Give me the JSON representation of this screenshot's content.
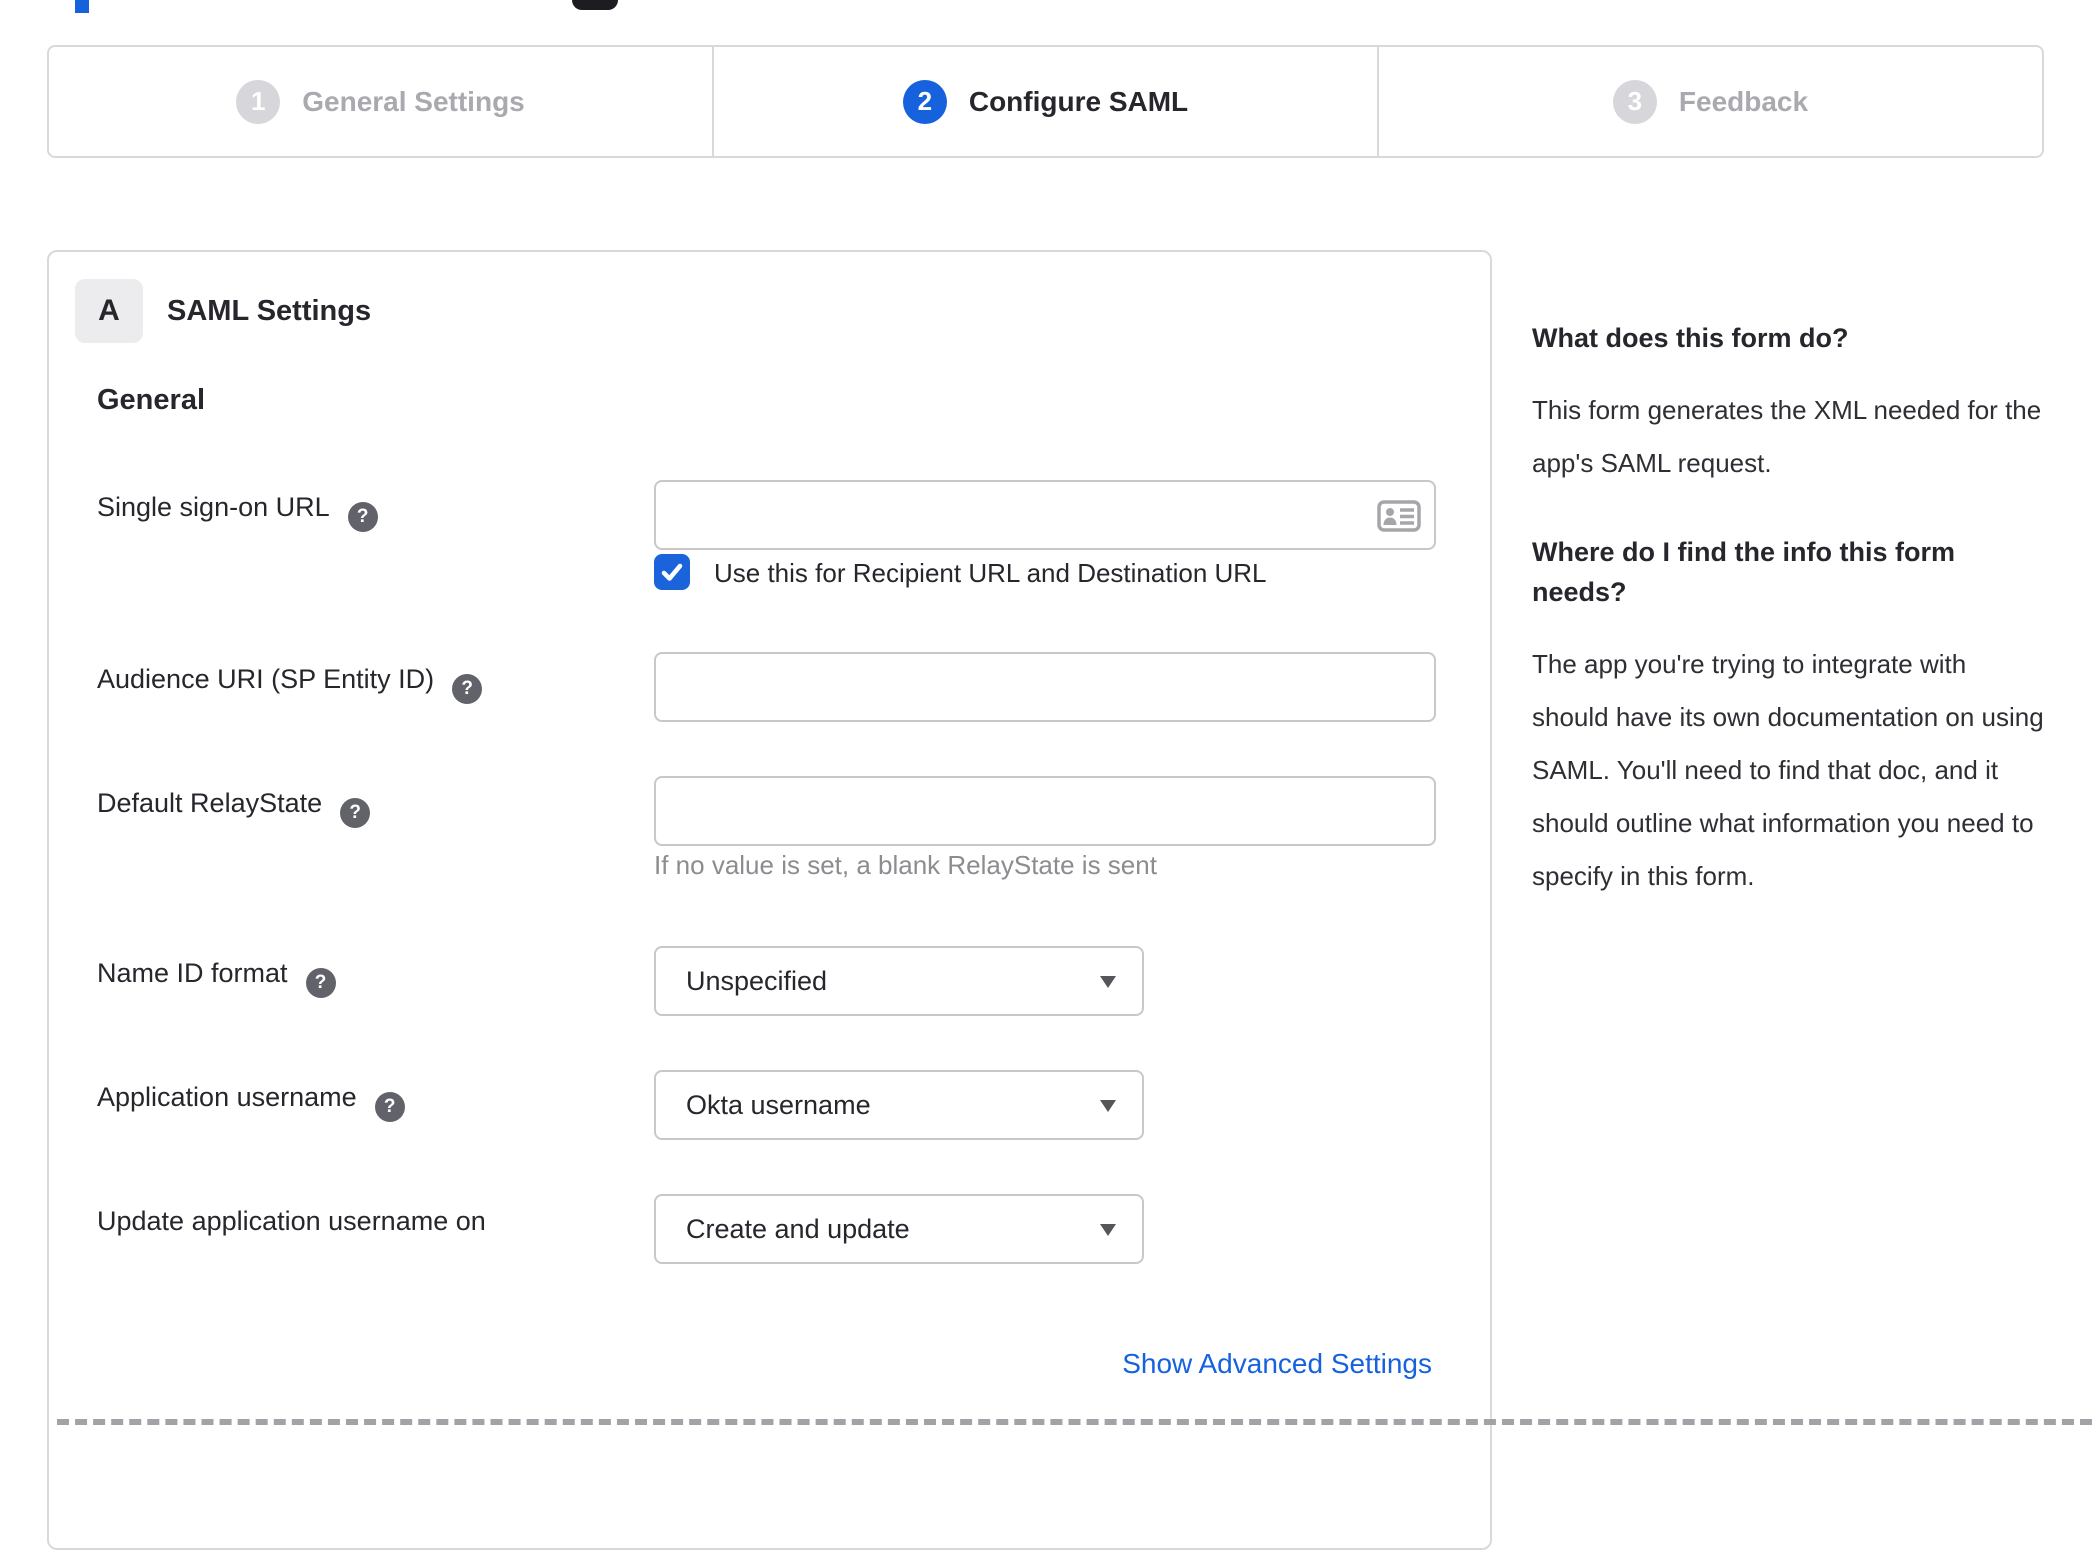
{
  "colors": {
    "accent_blue": "#1662dd",
    "dark_text": "#26262c",
    "inactive_gray": "#a9a9af",
    "hint_gray": "#8c8c91",
    "border_gray": "#d9d9dc",
    "input_border": "#c7c7cc"
  },
  "stepper": {
    "steps": [
      {
        "number": "1",
        "label": "General Settings",
        "state": "inactive"
      },
      {
        "number": "2",
        "label": "Configure SAML",
        "state": "active"
      },
      {
        "number": "3",
        "label": "Feedback",
        "state": "inactive"
      }
    ]
  },
  "panel": {
    "badge": "A",
    "title": "SAML Settings",
    "section_heading": "General",
    "help_glyph": "?",
    "fields": {
      "sso": {
        "label": "Single sign-on URL",
        "value": "",
        "checkbox_label": "Use this for Recipient URL and Destination URL",
        "checkbox_checked": true
      },
      "audience": {
        "label": "Audience URI (SP Entity ID)",
        "value": ""
      },
      "relay": {
        "label": "Default RelayState",
        "value": "",
        "hint": "If no value is set, a blank RelayState is sent"
      },
      "name_id": {
        "label": "Name ID format",
        "selected": "Unspecified"
      },
      "app_username": {
        "label": "Application username",
        "selected": "Okta username"
      },
      "update_username": {
        "label": "Update application username on",
        "selected": "Create and update"
      }
    },
    "advanced_link": "Show Advanced Settings"
  },
  "sidebar": {
    "section1": {
      "heading": "What does this form do?",
      "body": "This form generates the XML needed for the app's SAML request."
    },
    "section2": {
      "heading": "Where do I find the info this form needs?",
      "body": "The app you're trying to integrate with should have its own documentation on using SAML. You'll need to find that doc, and it should outline what information you need to specify in this form."
    }
  }
}
